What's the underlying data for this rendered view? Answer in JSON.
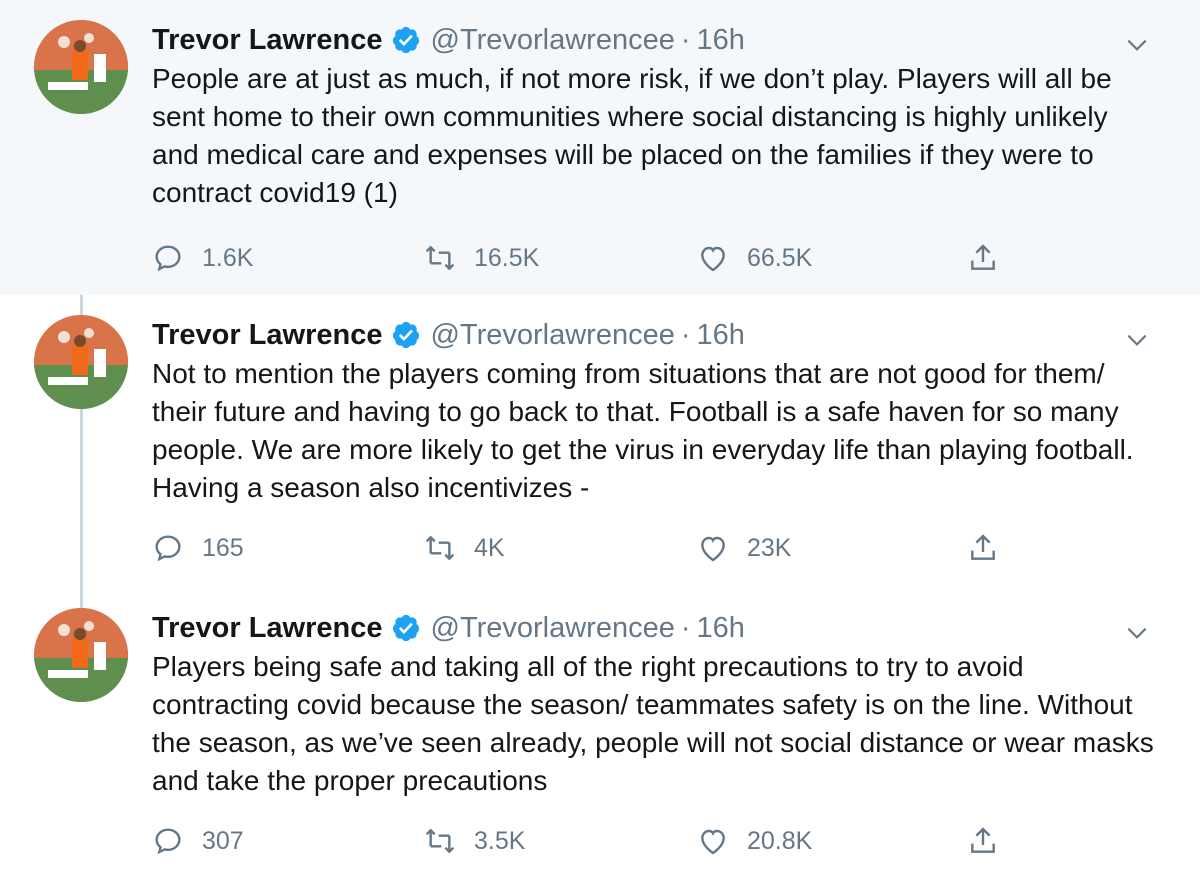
{
  "tweets": [
    {
      "name": "Trevor Lawrence",
      "handle": "@Trevorlawrencee",
      "separator": "·",
      "time": "16h",
      "text": "People are at just as much, if not more risk, if we don’t play. Players will all be sent home to their own communities where social distancing is highly unlikely and medical care and expenses will be placed on the families if they were to contract covid19 (1)",
      "replies": "1.6K",
      "retweets": "16.5K",
      "likes": "66.5K"
    },
    {
      "name": "Trevor Lawrence",
      "handle": "@Trevorlawrencee",
      "separator": "·",
      "time": "16h",
      "text": "Not to mention the players coming from situations that are not good for them/ their future and having to go back to that. Football is a safe haven for so many people. We are more likely to get the virus in everyday life than playing football. Having a season also incentivizes -",
      "replies": "165",
      "retweets": "4K",
      "likes": "23K"
    },
    {
      "name": "Trevor Lawrence",
      "handle": "@Trevorlawrencee",
      "separator": "·",
      "time": "16h",
      "text": "Players being safe and taking all of the right precautions to try to avoid contracting covid because the season/ teammates safety is on the line. Without the season, as we’ve seen already, people will not social distance or wear masks and take the proper precautions",
      "replies": "307",
      "retweets": "3.5K",
      "likes": "20.8K"
    }
  ],
  "icons": {
    "verified": "verified-badge-icon",
    "menu": "chevron-down-icon",
    "reply": "reply-icon",
    "retweet": "retweet-icon",
    "like": "heart-icon",
    "share": "share-icon"
  },
  "colors": {
    "highlight_bg": "#f5f8fa",
    "verified_blue": "#1da1f2",
    "secondary_text": "#657786",
    "thread_line": "#ccd6dd"
  }
}
